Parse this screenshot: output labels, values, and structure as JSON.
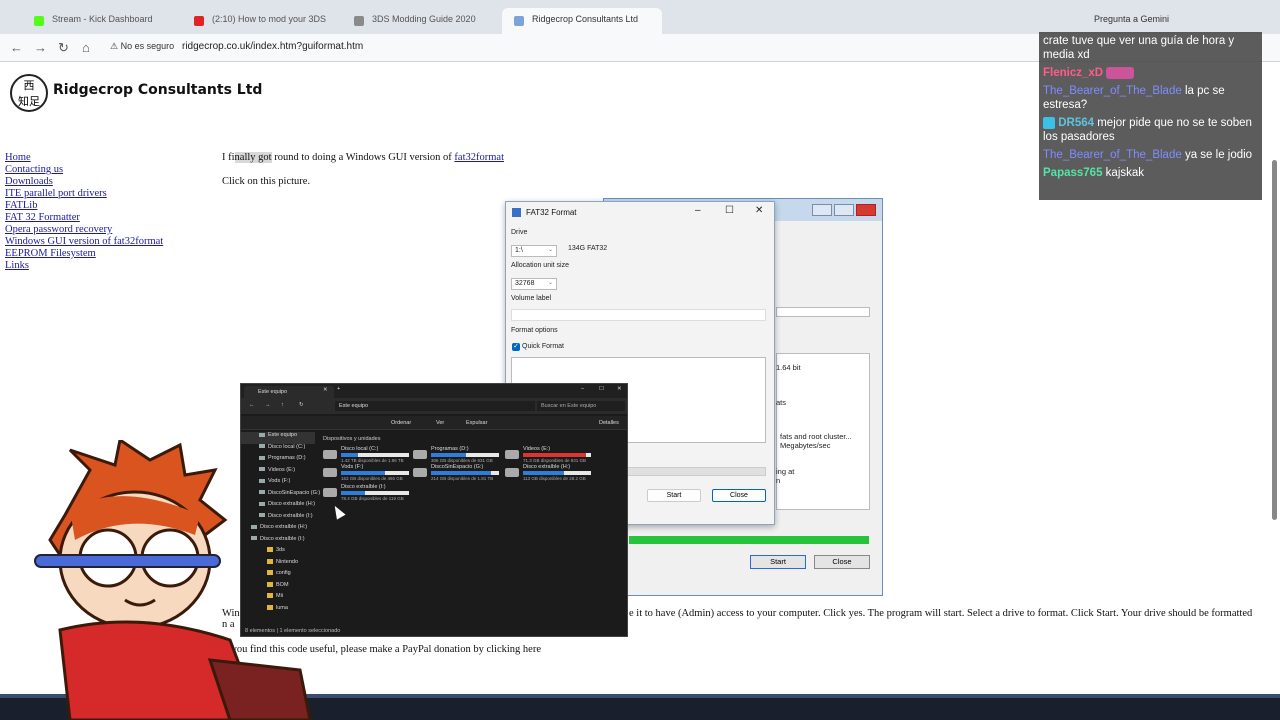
{
  "browser": {
    "tabs": [
      {
        "label": "Stream - Kick Dashboard",
        "active": false
      },
      {
        "label": "(2:10) How to mod your 3DS",
        "active": false
      },
      {
        "label": "3DS Modding Guide 2020",
        "active": false
      },
      {
        "label": "Ridgecrop Consultants Ltd",
        "active": true
      }
    ],
    "right_label": "Pregunta a Gemini",
    "security_label": "No es seguro",
    "url": "ridgecrop.co.uk/index.htm?guiformat.htm"
  },
  "site": {
    "logo_text": "西\n知足",
    "title": "Ridgecrop Consultants Ltd",
    "nav": [
      "Home",
      "Contacting us",
      "Downloads",
      "ITE parallel port drivers",
      "FATLib",
      "FAT 32 Formatter",
      "Opera password recovery",
      "Windows GUI version of fat32format",
      "EEPROM Filesystem",
      "Links"
    ],
    "intro_pre": "I fi",
    "intro_hl": "nally got",
    "intro_post": " round to doing a Windows GUI version of ",
    "intro_link": "fat32format",
    "click_text": "Click on this picture.",
    "bottom_left": "Win",
    "bottom_left2": "n a",
    "bottom_right": "e it to have (Admin) access to your computer. Click yes. The program will start. Select a drive to format. Click Start. Your drive should be formatted",
    "paypal_text": "If you find this code useful, please make a PayPal donation by clicking here"
  },
  "fat32_dialog": {
    "title": "FAT32 Format",
    "drive_label": "Drive",
    "drive_value": "1:\\",
    "drive_info": "134G FAT32",
    "alloc_label": "Allocation unit size",
    "alloc_value": "32768",
    "volume_label": "Volume label",
    "format_options": "Format options",
    "quick_format": "Quick Format",
    "start_label": "Start",
    "close_label": "Close"
  },
  "bg_dialog": {
    "text_64bit": "1.64 bit",
    "text_ats": "ats",
    "text_fats": "fats and root cluster...",
    "text_mbs": "Megabytes/sec",
    "text_ing": "ing at",
    "text_n": "n",
    "start_label": "Start",
    "close_label": "Close"
  },
  "explorer": {
    "tab_title": "Este equipo",
    "breadcrumb": "Este equipo",
    "search_placeholder": "Buscar en Este equipo",
    "cmd_order": "Ordenar",
    "cmd_view": "Ver",
    "cmd_filter": "Expulsar",
    "cmd_details": "Detalles",
    "section": "Dispositivos y unidades",
    "sidebar": [
      "Este equipo",
      "Disco local (C:)",
      "Programas (D:)",
      "Videos (E:)",
      "Vods (F:)",
      "DiscoSinEspacio (G:)",
      "Disco extraíble (H:)",
      "Disco extraíble (I:)",
      "Disco extraíble (H:)",
      "Disco extraíble (I:)",
      "3ds",
      "Nintendo",
      "config",
      "BOM",
      "Mii",
      "luma"
    ],
    "drives": [
      {
        "name": "Disco local (C:)",
        "space": "1.42 TB disponibles de 1.86 TB",
        "fill": 0.25,
        "red": false
      },
      {
        "name": "Programas (D:)",
        "space": "306 GB disponibles de 631 GB",
        "fill": 0.52,
        "red": false
      },
      {
        "name": "Videos (E:)",
        "space": "71.3 GB disponibles de 931 GB",
        "fill": 0.92,
        "red": true
      },
      {
        "name": "Vods (F:)",
        "space": "163 GB disponibles de 465 GB",
        "fill": 0.65,
        "red": false
      },
      {
        "name": "DiscoSinEspacio (G:)",
        "space": "214 GB disponibles de 1.81 TB",
        "fill": 0.88,
        "red": false
      },
      {
        "name": "Disco extraíble (H:)",
        "space": "113 GB disponibles de 28.2 GB",
        "fill": 0.6,
        "red": false
      },
      {
        "name": "Disco extraíble (I:)",
        "space": "78.4 GB disponibles de 119 GB",
        "fill": 0.35,
        "red": false
      }
    ],
    "status_left": "8 elementos",
    "status_right": "1 elemento seleccionado"
  },
  "chat": {
    "messages": [
      {
        "user": "",
        "text": "crate tuve que ver una guía de hora y media xd"
      },
      {
        "user": "Flenicz_xD",
        "text": ""
      },
      {
        "user": "The_Bearer_of_The_Blade",
        "text": "la pc se estresa?"
      },
      {
        "user": "DR564",
        "text": "mejor pide que no se te soben los pasadores"
      },
      {
        "user": "The_Bearer_of_The_Blade",
        "text": "ya se le jodio"
      },
      {
        "user": "Papass765",
        "text": "kajskak"
      }
    ]
  },
  "colors": {
    "link": "#1a1aa6",
    "accent": "#0067c0",
    "progress": "#25c43a"
  }
}
